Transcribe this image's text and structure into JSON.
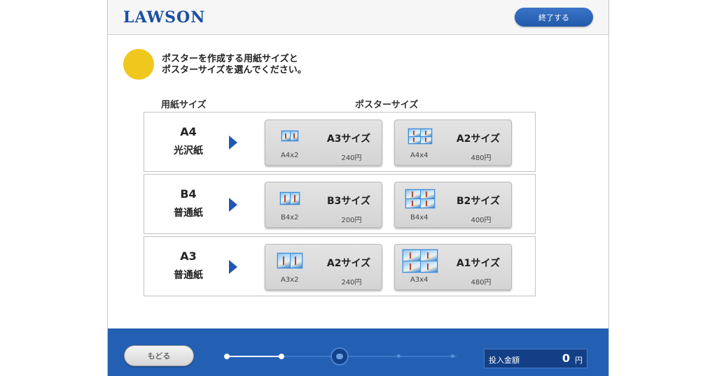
{
  "header": {
    "logo": "LAWSON",
    "end_button": "終了する"
  },
  "instruction": {
    "line1": "ポスターを作成する用紙サイズと",
    "line2": "ポスターサイズを選んでください。"
  },
  "columns": {
    "paper": "用紙サイズ",
    "poster": "ポスターサイズ"
  },
  "rows": [
    {
      "paper_size": "A4",
      "paper_type": "光沢紙",
      "options": [
        {
          "name": "A3サイズ",
          "layout": "A4x2",
          "price": "240円",
          "thumb": "2-panel-icon"
        },
        {
          "name": "A2サイズ",
          "layout": "A4x4",
          "price": "480円",
          "thumb": "4-panel-icon"
        }
      ]
    },
    {
      "paper_size": "B4",
      "paper_type": "普通紙",
      "options": [
        {
          "name": "B3サイズ",
          "layout": "B4x2",
          "price": "200円",
          "thumb": "2-panel-icon"
        },
        {
          "name": "B2サイズ",
          "layout": "B4x4",
          "price": "400円",
          "thumb": "4-panel-icon"
        }
      ]
    },
    {
      "paper_size": "A3",
      "paper_type": "普通紙",
      "options": [
        {
          "name": "A2サイズ",
          "layout": "A3x2",
          "price": "240円",
          "thumb": "2-panel-icon"
        },
        {
          "name": "A1サイズ",
          "layout": "A3x4",
          "price": "480円",
          "thumb": "4-panel-icon"
        }
      ]
    }
  ],
  "footer": {
    "back_button": "もどる",
    "amount_label": "投入金額",
    "amount_value": "0",
    "amount_unit": "円",
    "progress_current_step": 3,
    "progress_total_steps": 5
  },
  "colors": {
    "brand_blue": "#1c4fa0",
    "footer_blue": "#2360b4",
    "accent_yellow": "#f0c71d",
    "arrow_blue": "#1f57b4"
  }
}
